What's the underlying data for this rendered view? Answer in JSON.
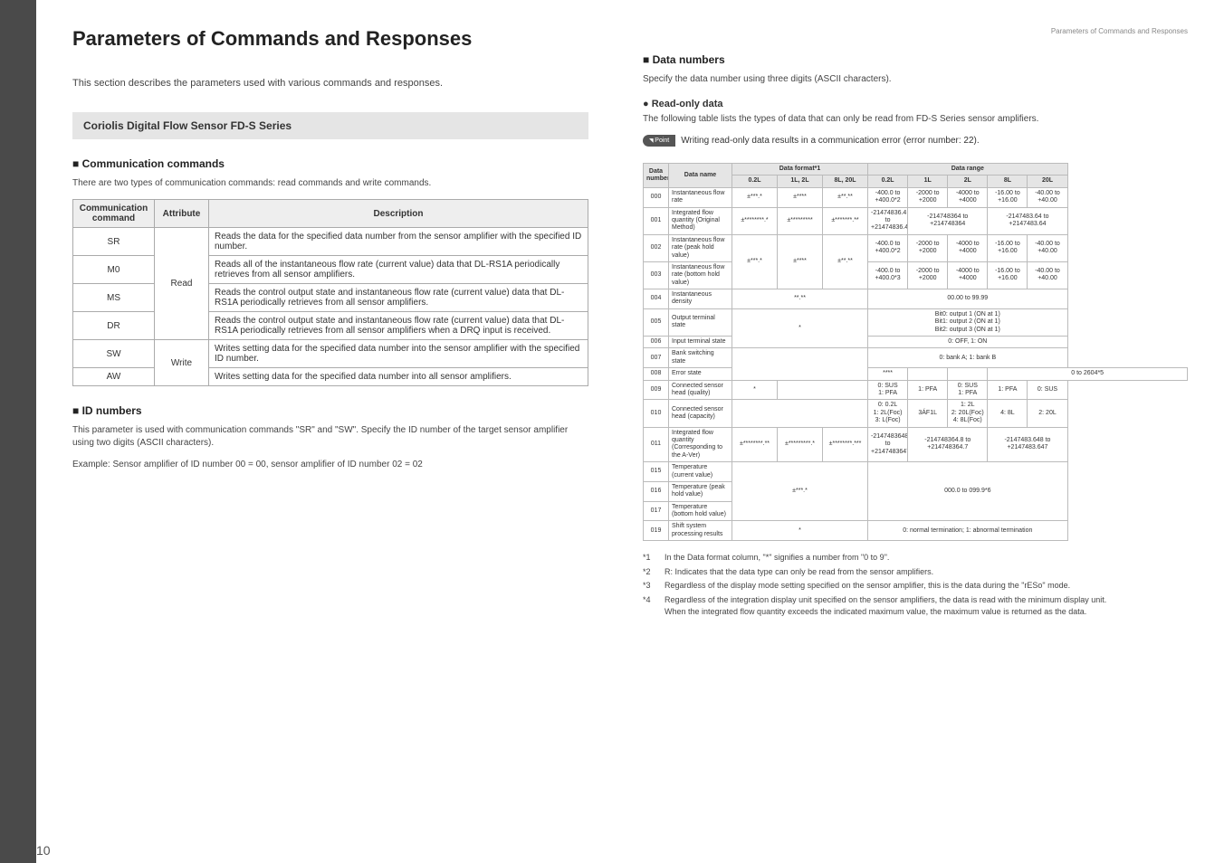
{
  "page": {
    "title": "Parameters of Commands and Responses",
    "number": "10"
  },
  "left": {
    "intro": "This section describes the parameters used with various commands and responses.",
    "series_bar": "Coriolis Digital Flow Sensor FD-S Series",
    "comm_head": "Communication commands",
    "comm_intro": "There are two types of communication commands: read commands and write commands.",
    "comm_table": {
      "headers": [
        "Communication command",
        "Attribute",
        "Description"
      ],
      "rows": [
        {
          "cmd": "SR",
          "attr": "Read",
          "desc": "Reads the data for the specified data number from the sensor amplifier with the specified ID number.",
          "attr_span": 4
        },
        {
          "cmd": "M0",
          "desc": "Reads all of the instantaneous flow rate (current value) data that DL-RS1A periodically retrieves from all sensor amplifiers."
        },
        {
          "cmd": "MS",
          "desc": "Reads the control output state and instantaneous flow rate (current value) data that DL-RS1A periodically retrieves from all sensor amplifiers."
        },
        {
          "cmd": "DR",
          "desc": "Reads the control output state and instantaneous flow rate (current value) data that DL-RS1A periodically retrieves from all sensor amplifiers when a DRQ input is received."
        },
        {
          "cmd": "SW",
          "attr": "Write",
          "desc": "Writes setting data for the specified data number into the sensor amplifier with the specified ID number.",
          "attr_span": 2
        },
        {
          "cmd": "AW",
          "desc": "Writes setting data for the specified data number into all sensor amplifiers."
        }
      ]
    },
    "id_head": "ID numbers",
    "id_text1": "This parameter is used with communication commands \"SR\" and \"SW\". Specify the ID number of the target sensor amplifier using two digits (ASCII characters).",
    "id_text2": "Example: Sensor amplifier of ID number 00 = 00, sensor amplifier of ID number 02 = 02"
  },
  "right": {
    "top_label": "Parameters of Commands and Responses",
    "data_head": "Data numbers",
    "data_intro": "Specify the data number using three digits (ASCII characters).",
    "readonly_head": "Read-only data",
    "readonly_intro": "The following table lists the types of data that can only be read from FD-S Series sensor amplifiers.",
    "point": {
      "tag": "Point",
      "text": "Writing read-only data results in a communication error (error number: 22)."
    },
    "table": {
      "h_num": "Data number",
      "h_name": "Data name",
      "h_format": "Data format*1",
      "h_range": "Data range",
      "fmt_cols": [
        "0.2L",
        "1L, 2L",
        "8L, 20L"
      ],
      "range_cols": [
        "0.2L",
        "1L",
        "2L",
        "8L",
        "20L"
      ],
      "rows": [
        {
          "num": "000",
          "name": "Instantaneous flow rate",
          "fmt": [
            "±***.*",
            "±****",
            "±**.**"
          ],
          "range": [
            "-400.0 to +400.0*2",
            "-2000 to +2000",
            "-4000 to +4000",
            "-16.00 to +16.00",
            "-40.00 to +40.00"
          ]
        },
        {
          "num": "001",
          "name": "Integrated flow quantity (Original Method)",
          "fmt": [
            "±********.*",
            "±*********",
            "±*******.**"
          ],
          "range_merge": [
            {
              "t": "-21474836.4 to +21474836.4*3",
              "s": 1
            },
            {
              "t": "-214748364 to +214748364",
              "s": 2
            },
            {
              "t": "-2147483.64 to +2147483.64",
              "s": 2
            }
          ]
        },
        {
          "num": "002",
          "name": "Instantaneous flow rate (peak hold value)",
          "fmt_row": {
            "cells": [
              "±***.*",
              "±****",
              "±**.**"
            ],
            "rowspan": 2
          },
          "range": [
            "-400.0 to +400.0*2",
            "-2000 to +2000",
            "-4000 to +4000",
            "-16.00 to +16.00",
            "-40.00 to +40.00"
          ]
        },
        {
          "num": "003",
          "name": "Instantaneous flow rate (bottom hold value)",
          "range": [
            "-400.0 to +400.0*3",
            "-2000 to +2000",
            "-4000 to +4000",
            "-16.00 to +16.00",
            "-40.00 to +40.00"
          ]
        },
        {
          "num": "004",
          "name": "Instantaneous density",
          "fmt_full": "**.**",
          "range_full": "00.00 to 99.99"
        },
        {
          "num": "005",
          "name": "Output terminal state",
          "fmt_full_row": {
            "t": "*",
            "s": 2
          },
          "range_full": "Bit0: output 1 (ON at 1)\nBit1: output 2 (ON at 1)\nBit2: output 3 (ON at 1)"
        },
        {
          "num": "006",
          "name": "Input terminal state",
          "range_full": "0: OFF, 1: ON"
        },
        {
          "num": "007",
          "name": "Bank switching state",
          "fmt_full_row": {
            "t": "",
            "s": 2,
            "empty": true
          },
          "range_full": "0: bank A; 1: bank B"
        },
        {
          "num": "008",
          "name": "Error state",
          "fmt": [
            "****",
            "",
            ""
          ],
          "range_full": "0 to 2604*5"
        },
        {
          "num": "009",
          "name": "Connected sensor head (quality)",
          "fmt_single": "*",
          "range": [
            "0: SUS\n1: PFA",
            "1: PFA",
            "0: SUS\n1: PFA",
            "1: PFA",
            "0: SUS"
          ]
        },
        {
          "num": "010",
          "name": "Connected sensor head (capacity)",
          "fmt_full": "",
          "range": [
            "0: 0.2L\n1: 2L(Foc)\n3: L(Foc)",
            "3ÁF1L",
            "1: 2L\n2: 20L(Foc)\n4: 8L(Foc)",
            "4: 8L",
            "2: 20L"
          ]
        },
        {
          "num": "011",
          "name": "Integrated flow quantity (Corresponding to the A-Ver)",
          "fmt": [
            "±********.**",
            "±*********.*",
            "±********.***"
          ],
          "range_merge": [
            {
              "t": "-2147483648 to +2147483647",
              "s": 1
            },
            {
              "t": "-214748364.8 to +214748364.7",
              "s": 2
            },
            {
              "t": "-2147483.648 to +2147483.647",
              "s": 2
            }
          ]
        },
        {
          "num": "015",
          "name": "Temperature (current value)",
          "fmt_full_row": {
            "t": "±***.*",
            "s": 3
          },
          "range_full_row": {
            "t": "000.0 to 099.9*6",
            "s": 3
          }
        },
        {
          "num": "016",
          "name": "Temperature (peak hold value)"
        },
        {
          "num": "017",
          "name": "Temperature (bottom hold value)"
        },
        {
          "num": "019",
          "name": "Shift system processing results",
          "fmt_full": "*",
          "range_full": "0: normal termination; 1: abnormal termination"
        }
      ]
    },
    "footnotes": [
      {
        "k": "*1",
        "t": "In the Data format column, \"*\" signifies a number from \"0 to 9\"."
      },
      {
        "k": "*2",
        "t": "R: Indicates that the data type can only be read from the sensor amplifiers."
      },
      {
        "k": "*3",
        "t": "Regardless of the display mode setting specified on the sensor amplifier, this is the data during the \"rESo\" mode."
      },
      {
        "k": "*4",
        "t": "Regardless of the integration display unit specified on the sensor amplifiers, the data is read with the minimum display unit.\nWhen the integrated flow quantity exceeds the indicated maximum value, the maximum value is returned as the data."
      }
    ]
  }
}
